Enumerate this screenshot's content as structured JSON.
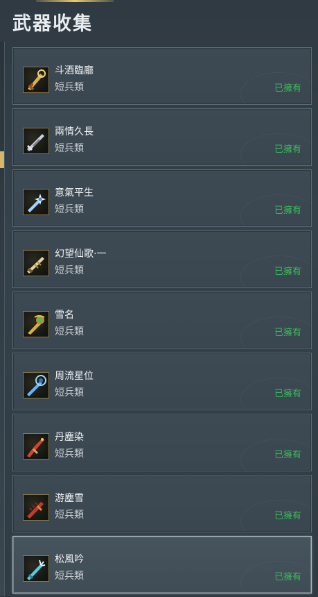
{
  "header": {
    "title": "武器收集"
  },
  "weapons": [
    {
      "name": "斗酒臨廳",
      "type": "短兵類",
      "status": "已擁有",
      "icon": "golden-ornate-blade-icon",
      "color": "#d8b054"
    },
    {
      "name": "兩情久長",
      "type": "短兵類",
      "status": "已擁有",
      "icon": "silver-dagger-icon",
      "color": "#c9d0d6"
    },
    {
      "name": "意氣平生",
      "type": "短兵類",
      "status": "已擁有",
      "icon": "crystal-star-blade-icon",
      "color": "#9fd4ff"
    },
    {
      "name": "幻望仙歌·一",
      "type": "短兵類",
      "status": "已擁有",
      "icon": "ivory-gold-blade-icon",
      "color": "#e2d3a0"
    },
    {
      "name": "雪名",
      "type": "短兵類",
      "status": "已擁有",
      "icon": "jade-gold-blade-icon",
      "color": "#d7b03c"
    },
    {
      "name": "周流星位",
      "type": "短兵類",
      "status": "已擁有",
      "icon": "blue-orb-blade-icon",
      "color": "#62b6ff"
    },
    {
      "name": "丹塵染",
      "type": "短兵類",
      "status": "已擁有",
      "icon": "crimson-curved-blade-icon",
      "color": "#d2452e"
    },
    {
      "name": "游塵雪",
      "type": "短兵類",
      "status": "已擁有",
      "icon": "red-serrated-blade-icon",
      "color": "#c63a28"
    },
    {
      "name": "松風吟",
      "type": "短兵類",
      "status": "已擁有",
      "icon": "cyan-spiked-blade-icon",
      "color": "#4fd0e6"
    }
  ]
}
